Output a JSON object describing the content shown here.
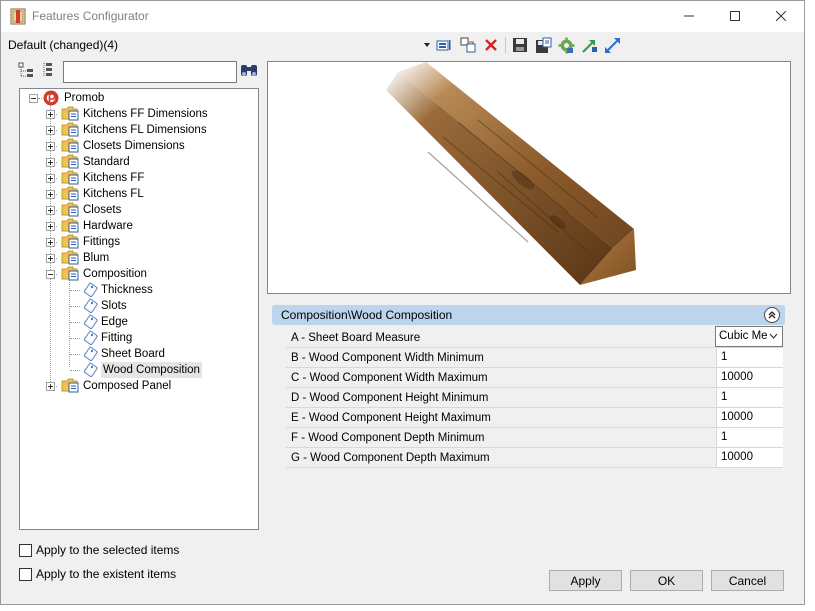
{
  "window": {
    "title": "Features Configurator",
    "accent": "#d03b2b"
  },
  "toolbar": {
    "preset_label": "Default (changed)(4)",
    "icons": [
      "add-icon",
      "copy-icon",
      "delete-icon",
      "save-icon",
      "save-as-icon",
      "settings-icon",
      "import-icon",
      "export-icon"
    ]
  },
  "search": {
    "value": "",
    "placeholder": ""
  },
  "tree": {
    "root": "Promob",
    "items": [
      "Kitchens FF Dimensions",
      "Kitchens FL Dimensions",
      "Closets Dimensions",
      "Standard",
      "Kitchens FF",
      "Kitchens FL",
      "Closets",
      "Hardware",
      "Fittings",
      "Blum",
      "Composition",
      "Composed Panel"
    ],
    "composition_children": [
      "Thickness",
      "Slots",
      "Edge",
      "Fitting",
      "Sheet Board",
      "Wood Composition"
    ],
    "selected": "Wood Composition"
  },
  "properties": {
    "title": "Composition\\Wood Composition",
    "rows": [
      {
        "label": "A - Sheet Board Measure",
        "value": "Cubic Me"
      },
      {
        "label": "B - Wood Component Width Minimum",
        "value": "1"
      },
      {
        "label": "C - Wood Component Width Maximum",
        "value": "10000"
      },
      {
        "label": "D - Wood Component Height Minimum",
        "value": "1"
      },
      {
        "label": "E - Wood Component Height Maximum",
        "value": "10000"
      },
      {
        "label": "F - Wood Component Depth Minimum",
        "value": "1"
      },
      {
        "label": "G - Wood Component Depth Maximum",
        "value": "10000"
      }
    ]
  },
  "options": {
    "apply_selected": "Apply to the selected items",
    "apply_existent": "Apply to the existent items"
  },
  "buttons": {
    "apply": "Apply",
    "ok": "OK",
    "cancel": "Cancel"
  }
}
